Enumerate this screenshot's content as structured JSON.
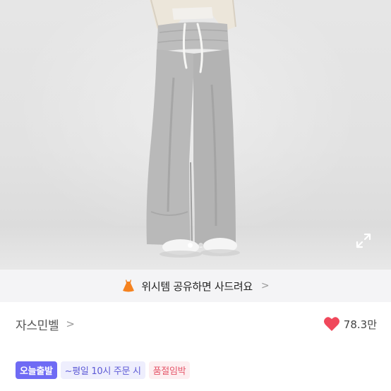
{
  "banner": {
    "text": "위시템 공유하면 사드려요",
    "chevron": ">",
    "icon": "orange-dress-icon"
  },
  "gallery": {
    "slide_count": 2,
    "active_slide": 1,
    "expand_icon": "expand-icon"
  },
  "seller": {
    "name": "자스민벨",
    "chevron": ">"
  },
  "likes": {
    "icon": "heart-icon",
    "count": "78.3만",
    "color": "#f0485b"
  },
  "badges": {
    "today": "오늘출발",
    "weekday": "~평일 10시 주문 시",
    "soldout": "품절임박"
  },
  "colors": {
    "badge_today_bg": "#6f6bf4",
    "banner_bg": "#f4f4f6",
    "banner_icon": "#f5821f"
  }
}
